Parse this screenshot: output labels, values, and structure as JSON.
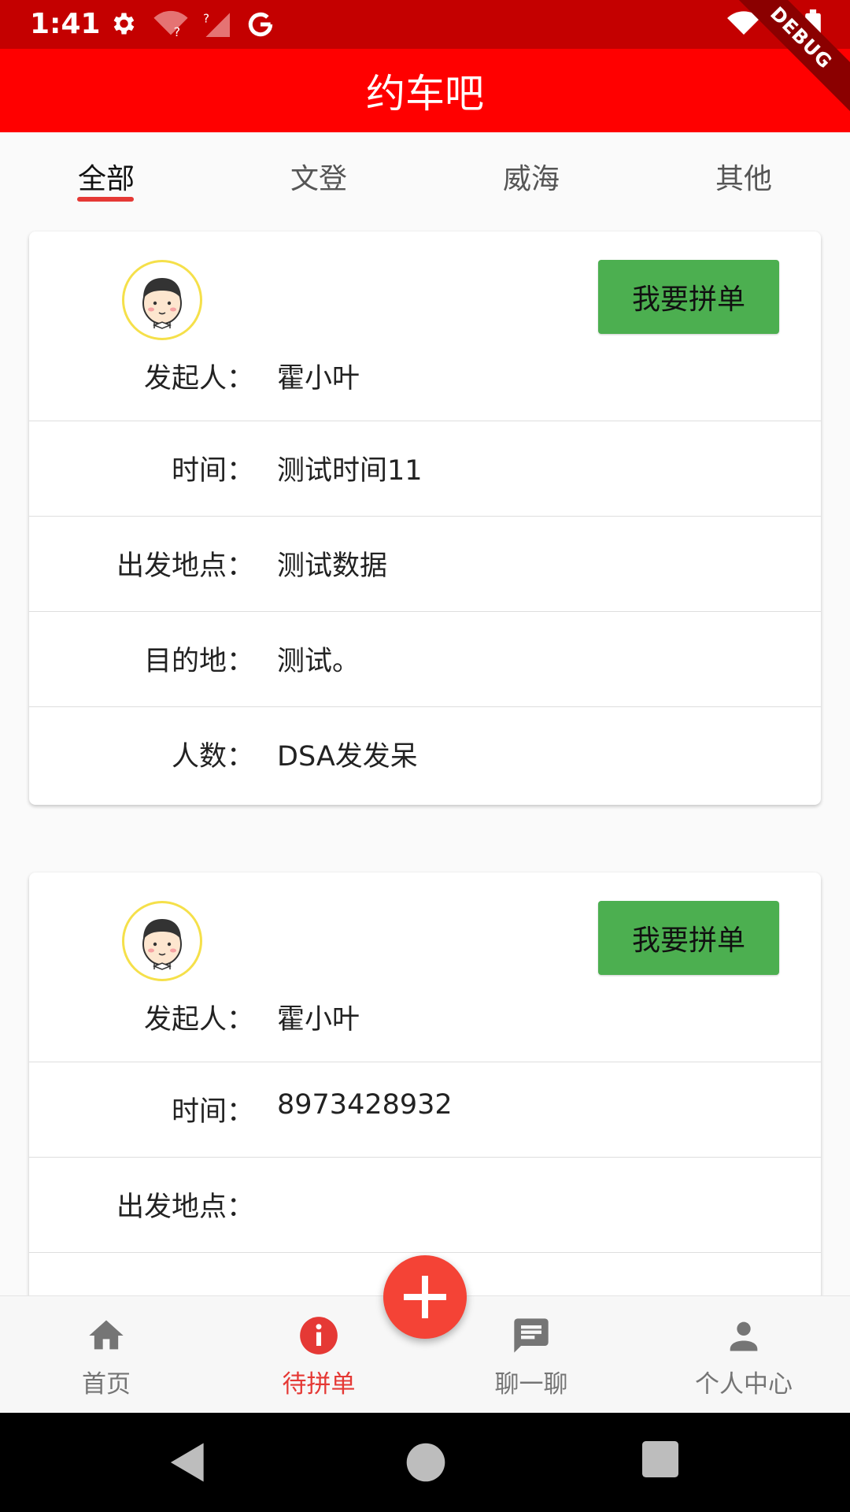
{
  "status_bar": {
    "time": "1:41",
    "debug_label": "DEBUG"
  },
  "app_bar": {
    "title": "约车吧"
  },
  "tabs": [
    {
      "label": "全部",
      "active": true
    },
    {
      "label": "文登",
      "active": false
    },
    {
      "label": "威海",
      "active": false
    },
    {
      "label": "其他",
      "active": false
    }
  ],
  "cards": [
    {
      "button_label": "我要拼单",
      "rows": [
        {
          "label": "发起人：",
          "value": "霍小叶"
        },
        {
          "label": "时间：",
          "value": "测试时间11"
        },
        {
          "label": "出发地点：",
          "value": "测试数据"
        },
        {
          "label": "目的地：",
          "value": "测试。"
        },
        {
          "label": "人数：",
          "value": "DSA发发呆"
        }
      ]
    },
    {
      "button_label": "我要拼单",
      "rows": [
        {
          "label": "发起人：",
          "value": "霍小叶"
        },
        {
          "label": "时间：",
          "value": "8973428932"
        },
        {
          "label": "出发地点：",
          "value": ""
        }
      ]
    }
  ],
  "bottom_nav": [
    {
      "label": "首页",
      "icon": "home-icon",
      "active": false
    },
    {
      "label": "待拼单",
      "icon": "info-icon",
      "active": true
    },
    {
      "label": "聊一聊",
      "icon": "chat-icon",
      "active": false
    },
    {
      "label": "个人中心",
      "icon": "person-icon",
      "active": false
    }
  ],
  "colors": {
    "status_bar": "#c40000",
    "app_bar": "#ff0000",
    "accent": "#e53935",
    "join_button": "#4caf50",
    "fab": "#f44336"
  }
}
